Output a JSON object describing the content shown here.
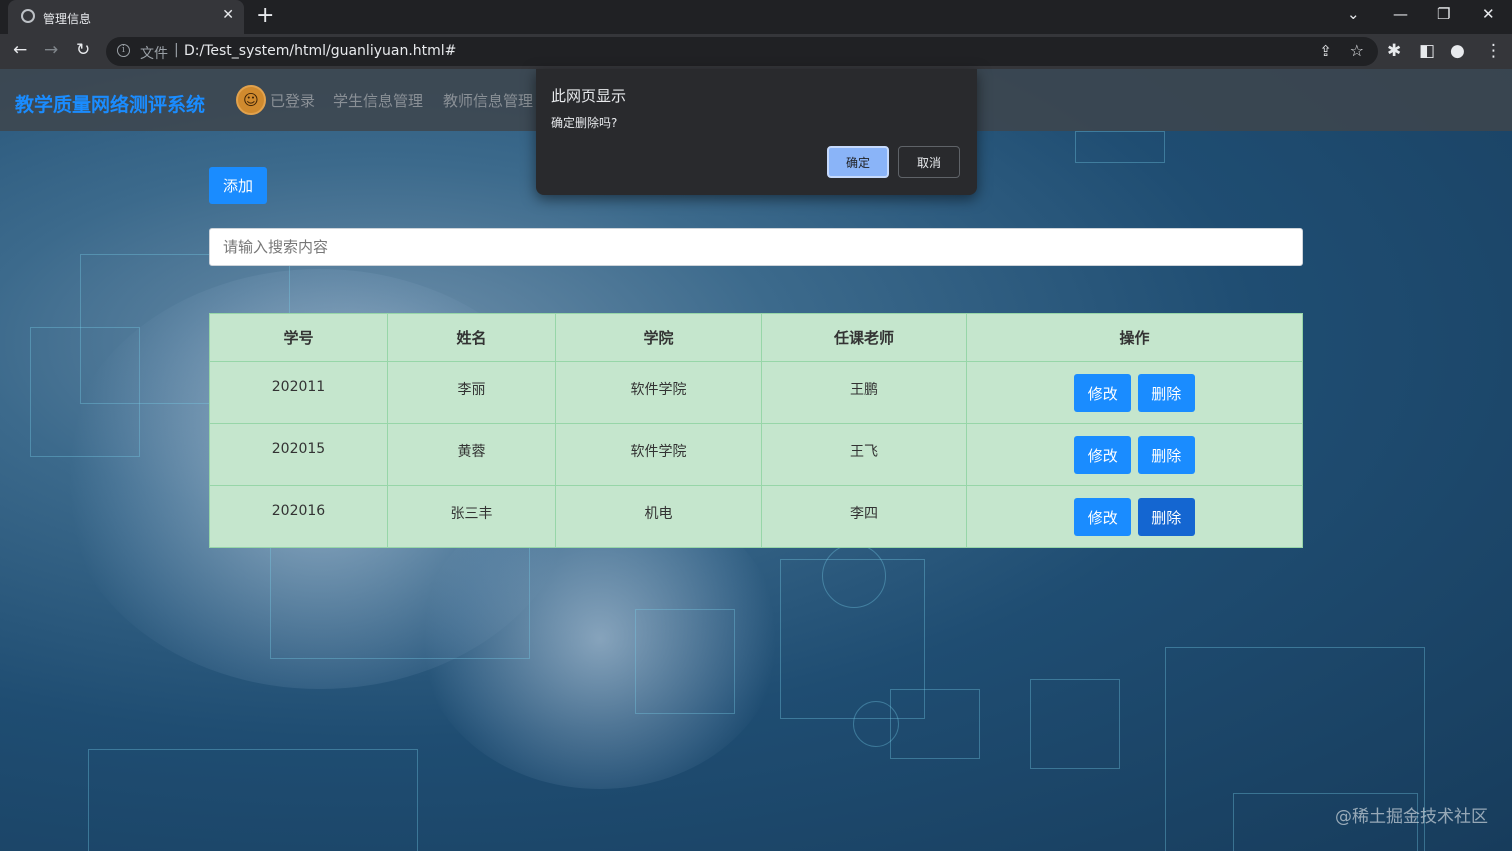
{
  "browser": {
    "tab_title": "管理信息",
    "url_scheme": "文件",
    "url": "D:/Test_system/html/guanliyuan.html#"
  },
  "site": {
    "brand": "教学质量网络测评系统",
    "nav": [
      "已登录",
      "学生信息管理",
      "教师信息管理"
    ]
  },
  "actions": {
    "add_label": "添加"
  },
  "search": {
    "placeholder": "请输入搜索内容"
  },
  "table": {
    "headers": [
      "学号",
      "姓名",
      "学院",
      "任课老师",
      "操作"
    ],
    "rows": [
      {
        "id": "202011",
        "name": "李丽",
        "college": "软件学院",
        "teacher": "王鹏",
        "edit": "修改",
        "delete": "删除"
      },
      {
        "id": "202015",
        "name": "黄蓉",
        "college": "软件学院",
        "teacher": "王飞",
        "edit": "修改",
        "delete": "删除"
      },
      {
        "id": "202016",
        "name": "张三丰",
        "college": "机电",
        "teacher": "李四",
        "edit": "修改",
        "delete": "删除"
      }
    ]
  },
  "dialog": {
    "title": "此网页显示",
    "message": "确定删除吗?",
    "ok": "确定",
    "cancel": "取消"
  },
  "watermark": "@稀土掘金技术社区",
  "colors": {
    "accent": "#1a8cff",
    "table_bg": "#c5e6cd",
    "dialog_bg": "#292a2d"
  }
}
